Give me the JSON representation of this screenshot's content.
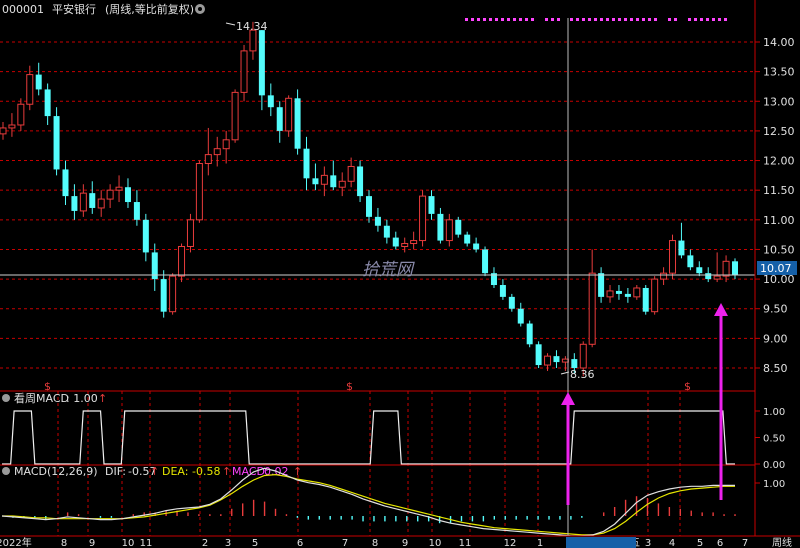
{
  "header": {
    "stock_code": "000001",
    "stock_name": "平安银行",
    "mode": "(周线,等比前复权)",
    "gear_icon": "gear-icon"
  },
  "price_axis": {
    "ticks": [
      "14.00",
      "13.50",
      "13.00",
      "12.50",
      "12.00",
      "11.50",
      "11.00",
      "10.50",
      "10.00",
      "9.50",
      "9.00",
      "8.50"
    ],
    "current_value": "10.07",
    "current_bg": "#1560a8"
  },
  "annotations": {
    "high_label": "14.34",
    "low_label": "8.36",
    "watermark": "拾荒网",
    "dollar_marker": "$"
  },
  "macd_sub": {
    "title": "看周MACD",
    "value_text": ": 1.00",
    "ticks": [
      "1.00",
      "0.50",
      "0.00"
    ]
  },
  "macd_main": {
    "title": "MACD(12,26,9)",
    "dif_label": "DIF:",
    "dif_value": "-0.57",
    "dea_label": "DEA:",
    "dea_value": "-0.58",
    "macd_label": "MACD:",
    "macd_value": "0.02",
    "tick": "1.00",
    "arrow": "↑"
  },
  "time_axis": {
    "labels": [
      "2022年",
      "8",
      "9",
      "10",
      "11",
      "2",
      "3",
      "5",
      "6",
      "7",
      "8",
      "9",
      "10",
      "11",
      "12",
      "1",
      "2024/02/02/五",
      "3",
      "4",
      "5",
      "6",
      "7"
    ],
    "period": "周线",
    "highlighted": "2024/02/02/五"
  },
  "colors": {
    "up": "#e83c3c",
    "down": "#54fcfc",
    "grid": "#c80000",
    "dif": "#e0e0e0",
    "dea": "#e6e600",
    "macd_text": "#ff44ff",
    "arrow": "#ee22ee"
  },
  "chart_data": [
    {
      "type": "candlestick",
      "period": "weekly",
      "ylim": [
        8.3,
        14.6
      ],
      "candles": [
        [
          12.45,
          12.65,
          12.35,
          12.55
        ],
        [
          12.55,
          12.8,
          12.4,
          12.6
        ],
        [
          12.6,
          13.05,
          12.5,
          12.95
        ],
        [
          12.95,
          13.6,
          12.85,
          13.45
        ],
        [
          13.45,
          13.65,
          13.1,
          13.2
        ],
        [
          13.2,
          13.3,
          12.6,
          12.75
        ],
        [
          12.75,
          12.9,
          11.75,
          11.85
        ],
        [
          11.85,
          12.0,
          11.25,
          11.4
        ],
        [
          11.4,
          11.6,
          11.0,
          11.15
        ],
        [
          11.15,
          11.6,
          11.05,
          11.45
        ],
        [
          11.45,
          11.65,
          11.1,
          11.2
        ],
        [
          11.2,
          11.5,
          11.05,
          11.35
        ],
        [
          11.35,
          11.6,
          11.2,
          11.5
        ],
        [
          11.5,
          11.75,
          11.3,
          11.55
        ],
        [
          11.55,
          11.7,
          11.2,
          11.3
        ],
        [
          11.3,
          11.5,
          10.9,
          11.0
        ],
        [
          11.0,
          11.1,
          10.3,
          10.45
        ],
        [
          10.45,
          10.6,
          9.8,
          10.0
        ],
        [
          10.0,
          10.15,
          9.35,
          9.45
        ],
        [
          9.45,
          10.1,
          9.4,
          10.05
        ],
        [
          10.05,
          10.6,
          9.95,
          10.55
        ],
        [
          10.55,
          11.1,
          10.45,
          11.0
        ],
        [
          11.0,
          12.0,
          10.95,
          11.95
        ],
        [
          11.95,
          12.55,
          11.75,
          12.1
        ],
        [
          12.1,
          12.4,
          11.9,
          12.2
        ],
        [
          12.2,
          12.5,
          11.95,
          12.35
        ],
        [
          12.35,
          13.2,
          12.3,
          13.15
        ],
        [
          13.15,
          13.95,
          13.0,
          13.85
        ],
        [
          13.85,
          14.34,
          13.7,
          14.2
        ],
        [
          14.2,
          14.2,
          12.85,
          13.1
        ],
        [
          13.1,
          13.3,
          12.75,
          12.9
        ],
        [
          12.9,
          13.0,
          12.3,
          12.5
        ],
        [
          12.5,
          13.1,
          12.4,
          13.05
        ],
        [
          13.05,
          13.2,
          12.1,
          12.2
        ],
        [
          12.2,
          12.4,
          11.5,
          11.7
        ],
        [
          11.7,
          11.95,
          11.5,
          11.6
        ],
        [
          11.6,
          11.9,
          11.4,
          11.75
        ],
        [
          11.75,
          12.0,
          11.5,
          11.55
        ],
        [
          11.55,
          11.8,
          11.4,
          11.65
        ],
        [
          11.65,
          12.05,
          11.55,
          11.9
        ],
        [
          11.9,
          12.0,
          11.3,
          11.4
        ],
        [
          11.4,
          11.5,
          10.95,
          11.05
        ],
        [
          11.05,
          11.2,
          10.8,
          10.9
        ],
        [
          10.9,
          11.0,
          10.6,
          10.7
        ],
        [
          10.7,
          10.8,
          10.5,
          10.55
        ],
        [
          10.55,
          10.7,
          10.45,
          10.6
        ],
        [
          10.6,
          10.8,
          10.5,
          10.65
        ],
        [
          10.65,
          11.5,
          10.55,
          11.4
        ],
        [
          11.4,
          11.5,
          11.0,
          11.1
        ],
        [
          11.1,
          11.2,
          10.6,
          10.65
        ],
        [
          10.65,
          11.1,
          10.55,
          11.0
        ],
        [
          11.0,
          11.05,
          10.7,
          10.75
        ],
        [
          10.75,
          10.8,
          10.55,
          10.6
        ],
        [
          10.6,
          10.7,
          10.45,
          10.5
        ],
        [
          10.5,
          10.55,
          10.05,
          10.1
        ],
        [
          10.1,
          10.2,
          9.85,
          9.9
        ],
        [
          9.9,
          10.0,
          9.65,
          9.7
        ],
        [
          9.7,
          9.75,
          9.45,
          9.5
        ],
        [
          9.5,
          9.6,
          9.2,
          9.25
        ],
        [
          9.25,
          9.3,
          8.85,
          8.9
        ],
        [
          8.9,
          8.95,
          8.5,
          8.55
        ],
        [
          8.55,
          8.75,
          8.45,
          8.7
        ],
        [
          8.7,
          8.8,
          8.5,
          8.6
        ],
        [
          8.6,
          8.7,
          8.45,
          8.65
        ],
        [
          8.65,
          8.75,
          8.4,
          8.5
        ],
        [
          8.5,
          8.95,
          8.36,
          8.9
        ],
        [
          8.9,
          10.5,
          8.85,
          10.1
        ],
        [
          10.1,
          10.2,
          9.6,
          9.7
        ],
        [
          9.7,
          9.9,
          9.6,
          9.8
        ],
        [
          9.8,
          9.9,
          9.65,
          9.75
        ],
        [
          9.75,
          9.85,
          9.6,
          9.7
        ],
        [
          9.7,
          9.9,
          9.65,
          9.85
        ],
        [
          9.85,
          9.9,
          9.4,
          9.45
        ],
        [
          9.45,
          10.05,
          9.4,
          10.0
        ],
        [
          10.0,
          10.2,
          9.9,
          10.1
        ],
        [
          10.1,
          10.75,
          10.0,
          10.65
        ],
        [
          10.65,
          10.95,
          10.35,
          10.4
        ],
        [
          10.4,
          10.5,
          10.15,
          10.2
        ],
        [
          10.2,
          10.3,
          10.05,
          10.1
        ],
        [
          10.1,
          10.2,
          9.95,
          10.0
        ],
        [
          10.0,
          10.45,
          9.95,
          10.05
        ],
        [
          10.05,
          10.4,
          9.95,
          10.3
        ],
        [
          10.3,
          10.35,
          10.0,
          10.07
        ]
      ],
      "annotations": [
        "14.34",
        "8.36"
      ],
      "current_price": 10.07
    },
    {
      "type": "step",
      "title": "看周MACD",
      "ylim": [
        0,
        1
      ],
      "values": [
        0,
        0,
        1,
        1,
        1,
        0,
        0,
        0,
        0,
        0,
        0,
        0,
        1,
        1,
        1,
        0,
        0,
        0,
        1,
        1,
        1,
        1,
        1,
        1,
        1,
        1,
        1,
        1,
        1,
        1,
        1,
        1,
        1,
        1,
        1,
        1,
        0,
        0,
        0,
        0,
        0,
        0,
        0,
        0,
        0,
        0,
        0,
        0,
        0,
        0,
        0,
        0,
        0,
        0,
        1,
        1,
        1,
        1,
        0,
        0,
        0,
        0,
        0,
        0,
        0,
        0,
        0,
        0,
        0,
        0,
        0,
        0,
        0,
        0,
        0,
        0,
        0,
        0,
        0,
        0,
        0,
        0,
        0,
        1,
        1,
        1,
        1,
        1,
        1,
        1,
        1,
        1,
        1,
        1,
        1,
        1,
        1,
        1,
        1,
        1,
        1,
        1,
        1,
        1,
        1,
        0,
        0
      ],
      "current": 1.0
    },
    {
      "type": "macd",
      "params": [
        12,
        26,
        9
      ],
      "series": [
        {
          "name": "DIF",
          "values": [
            -0.35,
            -0.36,
            -0.37,
            -0.38,
            -0.39,
            -0.38,
            -0.36,
            -0.37,
            -0.38,
            -0.39,
            -0.39,
            -0.38,
            -0.36,
            -0.34,
            -0.32,
            -0.29,
            -0.27,
            -0.26,
            -0.25,
            -0.22,
            -0.16,
            -0.06,
            0.05,
            0.14,
            0.18,
            0.15,
            0.1,
            0.05,
            0.02,
            0.0,
            -0.03,
            -0.07,
            -0.11,
            -0.16,
            -0.2,
            -0.24,
            -0.27,
            -0.3,
            -0.33,
            -0.36,
            -0.4,
            -0.43,
            -0.45,
            -0.47,
            -0.49,
            -0.5,
            -0.51,
            -0.52,
            -0.53,
            -0.54,
            -0.55,
            -0.56,
            -0.57,
            -0.57,
            -0.56,
            -0.52,
            -0.44,
            -0.32,
            -0.2,
            -0.12,
            -0.08,
            -0.05,
            -0.03,
            -0.02,
            -0.02,
            -0.01,
            -0.01,
            -0.01
          ]
        },
        {
          "name": "DEA",
          "values": [
            -0.35,
            -0.35,
            -0.36,
            -0.37,
            -0.37,
            -0.38,
            -0.38,
            -0.38,
            -0.38,
            -0.38,
            -0.38,
            -0.38,
            -0.37,
            -0.36,
            -0.34,
            -0.32,
            -0.3,
            -0.28,
            -0.26,
            -0.23,
            -0.17,
            -0.1,
            -0.02,
            0.05,
            0.1,
            0.11,
            0.09,
            0.06,
            0.04,
            0.02,
            -0.01,
            -0.05,
            -0.09,
            -0.13,
            -0.17,
            -0.21,
            -0.24,
            -0.27,
            -0.3,
            -0.33,
            -0.36,
            -0.39,
            -0.42,
            -0.44,
            -0.46,
            -0.48,
            -0.49,
            -0.5,
            -0.51,
            -0.52,
            -0.53,
            -0.54,
            -0.55,
            -0.56,
            -0.56,
            -0.54,
            -0.49,
            -0.41,
            -0.31,
            -0.22,
            -0.15,
            -0.1,
            -0.07,
            -0.05,
            -0.04,
            -0.03,
            -0.02,
            -0.02
          ]
        }
      ],
      "dif": -0.57,
      "dea": -0.58,
      "macd": 0.02
    }
  ]
}
